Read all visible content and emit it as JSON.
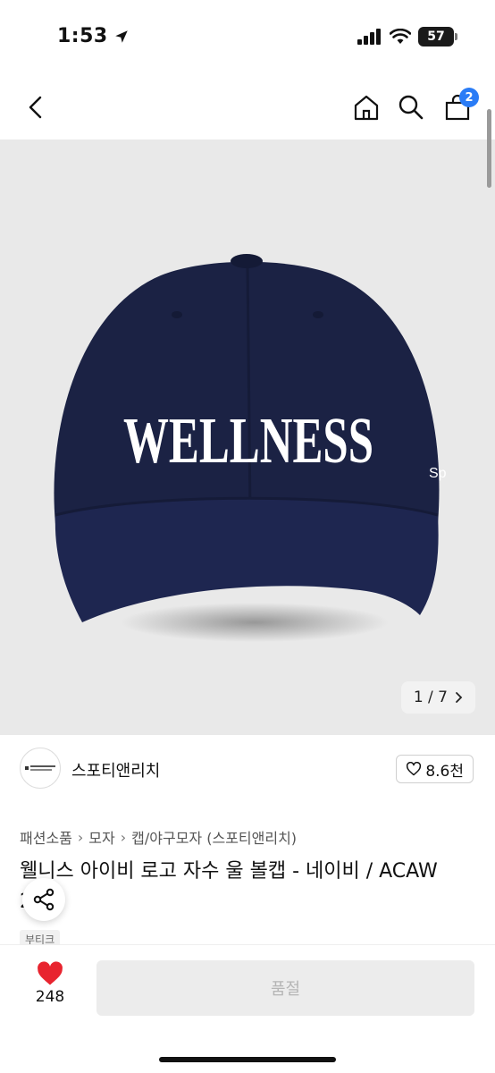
{
  "status_bar": {
    "time": "1:53",
    "battery": "57"
  },
  "nav": {
    "cart_count": "2"
  },
  "image": {
    "logo_text": "WELLNESS",
    "side_text": "Sp",
    "counter": "1 / 7"
  },
  "brand": {
    "name": "스포티앤리치",
    "likes": "8.6천"
  },
  "breadcrumb": [
    "패션소품",
    "모자",
    "캡/야구모자 (스포티앤리치)"
  ],
  "product": {
    "title": "웰니스 아이비 로고 자수 울 볼캡 - 네이비 / ACAW 2NA",
    "tag": "부티크"
  },
  "bottom": {
    "wish_count": "248",
    "soldout_label": "품절"
  },
  "colors": {
    "accent": "#2a7cf6",
    "heart": "#e8242f",
    "cap": "#1b2244"
  }
}
